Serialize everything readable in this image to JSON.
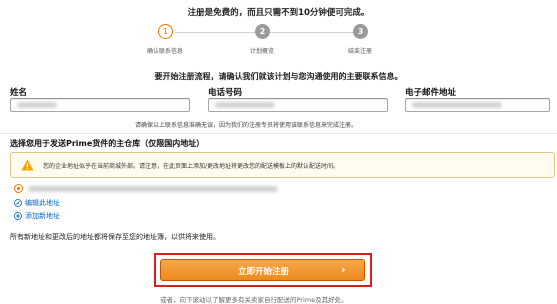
{
  "intro_text": "注册是免费的，而且只需不到10分钟便可完成。",
  "steps": [
    {
      "number": "1",
      "label": "确认联系信息",
      "active": true
    },
    {
      "number": "2",
      "label": "计划概览",
      "active": false
    },
    {
      "number": "3",
      "label": "结束注册",
      "active": false
    }
  ],
  "contact_header": "要开始注册流程，请确认我们就该计划与您沟通使用的主要联系信息。",
  "fields": {
    "name_label": "姓名",
    "phone_label": "电话号码",
    "email_label": "电子邮件地址"
  },
  "contact_note": "请确保以上联系信息准确无误，因为我们的注册专员将使用该联系信息来完成注册。",
  "warehouse": {
    "title": "选择您用于发送Prime货件的主仓库（仅限国内地址）",
    "warning_text": "您的企业地址似乎在当前商城外部。请注意，在此页面上添加/更改地址将更改您的配送模板上的默认配送时间。",
    "warning_icon": "warning-triangle",
    "edit_address_link": "编辑此地址",
    "add_address_link": "添加新地址"
  },
  "address_saved_note": "所有新地址和更改后的地址都将保存至您的地址簿，以供将来使用。",
  "cta": {
    "label": "立即开始注册",
    "arrow": "›"
  },
  "footer_partial": "或者，向下滚动以了解更多有关卖家自行配送的Prime及其好处。",
  "colors": {
    "accent": "#e77600",
    "link": "#0066c0",
    "highlight": "#d9201d",
    "warning": "#f0a500"
  }
}
